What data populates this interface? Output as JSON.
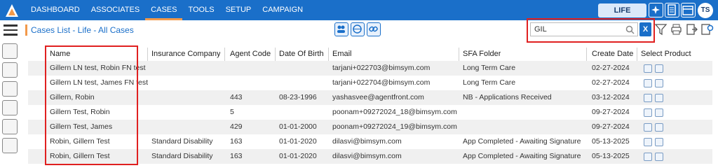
{
  "nav": {
    "items": [
      {
        "label": "DASHBOARD"
      },
      {
        "label": "ASSOCIATES"
      },
      {
        "label": "CASES"
      },
      {
        "label": "TOOLS"
      },
      {
        "label": "SETUP"
      },
      {
        "label": "CAMPAIGN"
      }
    ],
    "active": "CASES",
    "product": "LIFE",
    "user_initials": "TS"
  },
  "page": {
    "title": "Cases List - Life - All Cases"
  },
  "search": {
    "value": "GIL",
    "clear_label": "X"
  },
  "table": {
    "columns": [
      "Name",
      "Insurance Company",
      "Agent Code",
      "Date Of Birth",
      "Email",
      "SFA Folder",
      "Create Date",
      "Select Product"
    ],
    "rows": [
      {
        "name": "Gillern LN test, Robin FN test",
        "company": "",
        "agent": "",
        "dob": "",
        "email": "tarjani+022703@bimsym.com",
        "folder": "Long Term Care",
        "created": "02-27-2024"
      },
      {
        "name": "Gillern LN test, James FN test",
        "company": "",
        "agent": "",
        "dob": "",
        "email": "tarjani+022704@bimsym.com",
        "folder": "Long Term Care",
        "created": "02-27-2024"
      },
      {
        "name": "Gillern, Robin",
        "company": "",
        "agent": "443",
        "dob": "08-23-1996",
        "email": "yashasvee@agentfront.com",
        "folder": "NB - Applications Received",
        "created": "03-12-2024"
      },
      {
        "name": "Gillern Test, Robin",
        "company": "",
        "agent": "5",
        "dob": "",
        "email": "poonam+09272024_18@bimsym.com",
        "folder": "",
        "created": "09-27-2024"
      },
      {
        "name": "Gillern Test, James",
        "company": "",
        "agent": "429",
        "dob": "01-01-2000",
        "email": "poonam+09272024_19@bimsym.com",
        "folder": "",
        "created": "09-27-2024"
      },
      {
        "name": "Robin, Gillern Test",
        "company": "Standard Disability",
        "agent": "163",
        "dob": "01-01-2020",
        "email": "dilasvi@bimsym.com",
        "folder": "App Completed - Awaiting Signature",
        "created": "05-13-2025"
      },
      {
        "name": "Robin, Gillern Test",
        "company": "Standard Disability",
        "agent": "163",
        "dob": "01-01-2020",
        "email": "dilasvi@bimsym.com",
        "folder": "App Completed - Awaiting Signature",
        "created": "05-13-2025"
      }
    ]
  }
}
